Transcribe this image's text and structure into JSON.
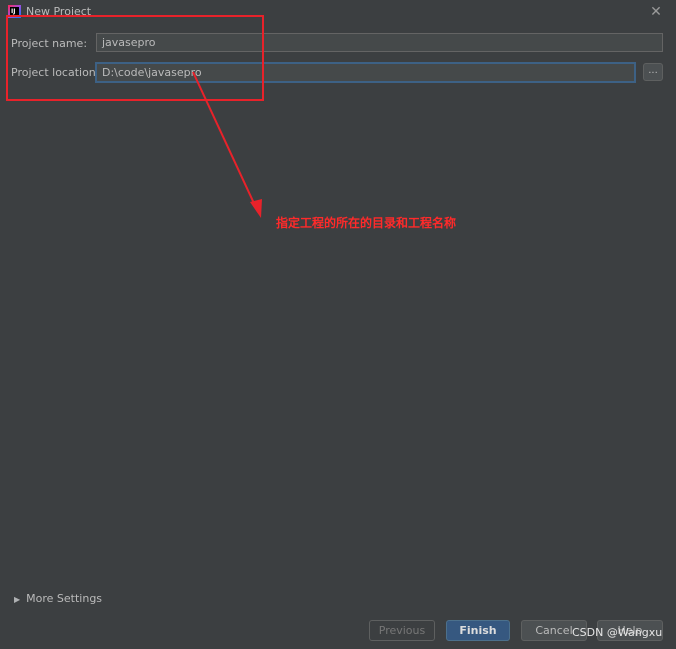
{
  "window": {
    "title": "New Project",
    "app_icon": "intellij-idea-icon",
    "app_icon_label": "IJ",
    "close_glyph": "✕"
  },
  "form": {
    "project_name_label": "Project name:",
    "project_name_value": "javasepro",
    "project_location_label": "Project location:",
    "project_location_value": "D:\\code\\javasepro",
    "browse_label": "..."
  },
  "annotation": {
    "text": "指定工程的所在的目录和工程名称",
    "color": "#e8222a"
  },
  "more_settings": {
    "label": "More Settings",
    "toggle_glyph": "▶"
  },
  "buttons": {
    "previous": "Previous",
    "finish": "Finish",
    "cancel": "Cancel",
    "help": "Help"
  },
  "watermark": "CSDN @Wangxu"
}
